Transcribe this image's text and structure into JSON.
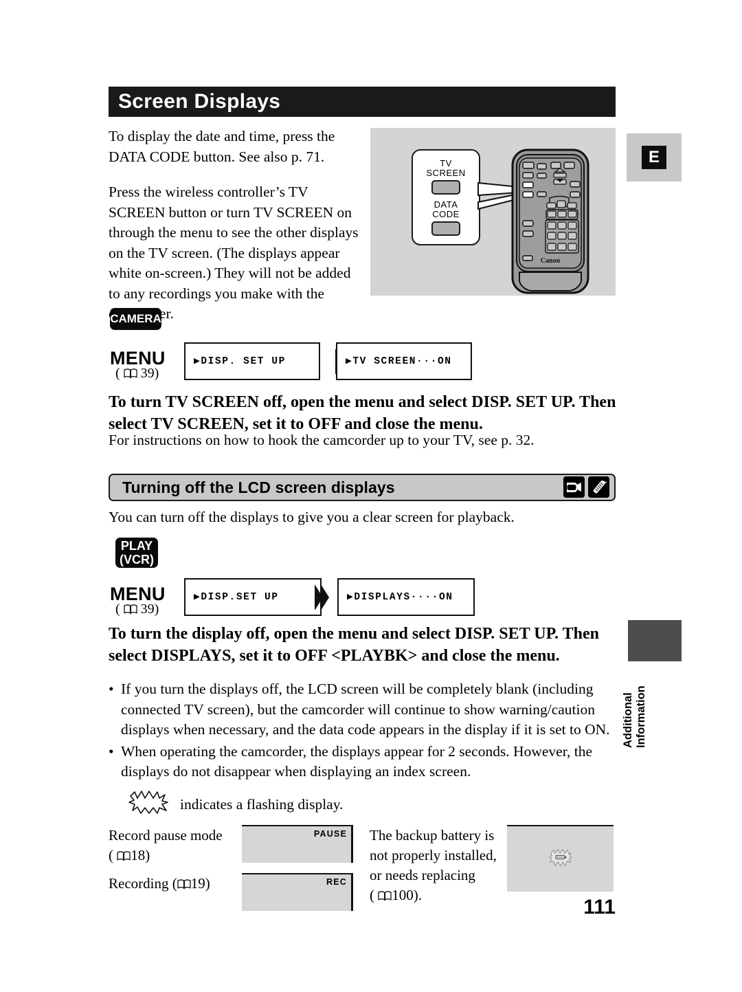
{
  "page": {
    "number": "111",
    "language_tab": "E",
    "side_tab_label": "Additional\nInformation"
  },
  "header": {
    "title": "Screen Displays"
  },
  "intro": {
    "para1": "To display the date and time, press the DATA CODE button. See also p. 71.",
    "para2": "Press the wireless controller’s TV SCREEN button or turn TV SCREEN on through the menu to see the other displays on the TV screen. (The displays appear white on-screen.) They will not be added to any recordings you make with the camcorder."
  },
  "remote_figure": {
    "callout_label_line1": "TV",
    "callout_label_line2": "SCREEN",
    "callout_label_line3": "DATA",
    "callout_label_line4": "CODE",
    "brand": "Canon"
  },
  "camera_step": {
    "badge": "CAMERA",
    "menu_label": "MENU",
    "menu_ref_prefix": "(",
    "menu_ref_page": "39",
    "menu_ref_suffix": ")",
    "box1": "▶DISP. SET UP",
    "box2": "▶TV SCREEN···ON",
    "instruction_bold": "To turn TV SCREEN off, open the menu and select DISP. SET UP. Then select TV SCREEN, set it to OFF and close the menu.",
    "instruction_plain": "For instructions on how to hook the camcorder up to your TV, see p. 32."
  },
  "section": {
    "heading": "Turning off the LCD screen displays",
    "icon1": "camcorder-icon",
    "icon2": "wireless-controller-icon",
    "intro": "You can turn off the displays to give you a clear screen for playback."
  },
  "play_step": {
    "badge_line1": "PLAY",
    "badge_line2": "(VCR)",
    "menu_label": "MENU",
    "menu_ref_prefix": "(",
    "menu_ref_page": "39",
    "menu_ref_suffix": ")",
    "box1": "▶DISP.SET UP",
    "box2": "▶DISPLAYS····ON",
    "instruction_bold": "To turn the display off, open the menu and select DISP. SET UP. Then select DISPLAYS, set it to OFF <PLAYBK> and close the menu."
  },
  "bullets": [
    "If you turn the displays off, the LCD screen will be completely blank (including connected TV screen), but the camcorder will continue to show warning/caution displays when necessary, and the data code appears in the display if it is set to ON.",
    "When operating the camcorder, the displays appear for 2 seconds. However, the displays do not disappear when displaying an index screen."
  ],
  "flash_note": {
    "icon": "flashing-burst-icon",
    "text": "indicates a flashing display."
  },
  "display_table": [
    {
      "label_line1": "Record pause mode",
      "label_line2_prefix": "(",
      "label_line2_page": "18",
      "label_line2_suffix": ")",
      "indicator": "PAUSE"
    },
    {
      "label_line1": "Recording (",
      "label_line2_page": "19",
      "label_line2_suffix": ")",
      "indicator": "REC"
    },
    {
      "label_line1": "The backup battery is",
      "label_line2": "not properly installed,",
      "label_line3": "or needs replacing",
      "label_line4_prefix": "(",
      "label_line4_page": "100",
      "label_line4_suffix": ").",
      "indicator": "flashing-battery-icon"
    }
  ]
}
